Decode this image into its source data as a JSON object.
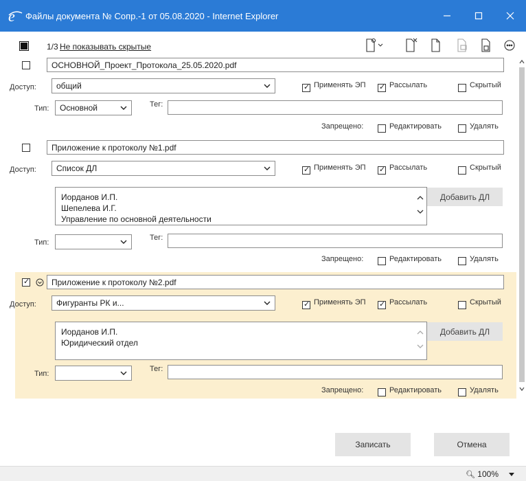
{
  "window": {
    "title": "Файлы документа № Сопр.-1 от 05.08.2020 - Internet Explorer",
    "icon": "ie-icon",
    "title_bar_color": "#2b7bd6"
  },
  "toolbar": {
    "counter": "1/3",
    "hide_link": "Не показывать скрытые",
    "icons": [
      "add-file-icon",
      "delete-file-icon",
      "copy-file-icon",
      "convert-file-icon",
      "save-file-icon",
      "more-icon"
    ]
  },
  "labels": {
    "access": "Доступ:",
    "type": "Тип:",
    "tag": "Тег:",
    "forbidden": "Запрещено:",
    "apply_ep": "Применять ЭП",
    "send": "Рассылать",
    "hidden": "Скрытый",
    "edit": "Редактировать",
    "delete": "Удалять",
    "add_dl": "Добавить ДЛ"
  },
  "files": [
    {
      "name": "ОСНОВНОЙ_Проект_Протокола_25.05.2020.pdf",
      "checked": false,
      "access": "общий",
      "type": "Основной",
      "tag": "",
      "apply_ep": true,
      "send": true,
      "hidden": false,
      "forbid_edit": false,
      "forbid_delete": false
    },
    {
      "name": "Приложение к протоколу №1.pdf",
      "checked": false,
      "access": "Список ДЛ",
      "recipients": [
        "Иорданов И.П.",
        "Шепелева И.Г.",
        "Управление по основной деятельности"
      ],
      "type": "",
      "tag": "",
      "apply_ep": true,
      "send": true,
      "hidden": false,
      "forbid_edit": false,
      "forbid_delete": false
    },
    {
      "name": "Приложение к протоколу №2.pdf",
      "checked": true,
      "access": "Фигуранты РК и...",
      "recipients": [
        "Иорданов И.П.",
        "Юридический отдел"
      ],
      "type": "",
      "tag": "",
      "apply_ep": true,
      "send": true,
      "hidden": false,
      "forbid_edit": false,
      "forbid_delete": false
    }
  ],
  "footer": {
    "save": "Записать",
    "cancel": "Отмена"
  },
  "statusbar": {
    "zoom": "100%"
  },
  "colors": {
    "selected_block": "#fcefcf",
    "button_gray": "#e4e4e4"
  }
}
